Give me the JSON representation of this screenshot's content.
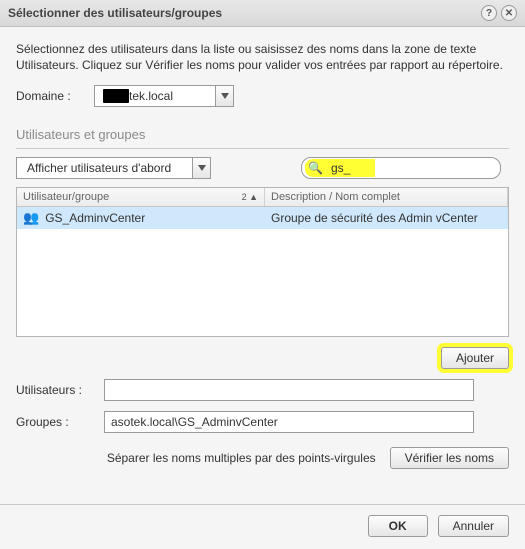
{
  "title": "Sélectionner des utilisateurs/groupes",
  "intro": "Sélectionnez des utilisateurs dans la liste ou saisissez des noms dans la zone de texte Utilisateurs. Cliquez sur Vérifier les noms pour valider vos entrées par rapport au répertoire.",
  "domain": {
    "label": "Domaine :",
    "masked_prefix": "---",
    "value_suffix": "tek.local"
  },
  "section_title": "Utilisateurs et groupes",
  "filter": {
    "value": "Afficher utilisateurs d'abord"
  },
  "search": {
    "value": "gs_"
  },
  "table": {
    "columns": {
      "col1": "Utilisateur/groupe",
      "col2": "Description / Nom complet",
      "sort_ind": "2 ▲"
    },
    "rows": [
      {
        "icon": "group",
        "name": "GS_AdminvCenter",
        "desc": "Groupe de sécurité des Admin vCenter",
        "selected": true
      }
    ]
  },
  "buttons": {
    "add": "Ajouter",
    "verify": "Vérifier les noms",
    "ok": "OK",
    "cancel": "Annuler"
  },
  "fields": {
    "users_label": "Utilisateurs :",
    "users_value": "",
    "groups_label": "Groupes :",
    "groups_value": "asotek.local\\GS_AdminvCenter"
  },
  "verify_hint": "Séparer les noms multiples par des points-virgules"
}
